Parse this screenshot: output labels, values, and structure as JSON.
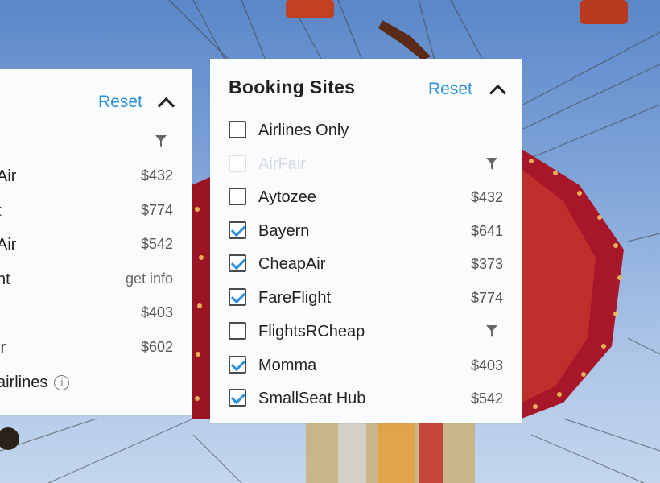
{
  "left_panel": {
    "reset_label": "Reset",
    "rows": [
      {
        "name": "Air",
        "price": "$432"
      },
      {
        "name": "t",
        "price": "$774"
      },
      {
        "name": "Air",
        "price": "$542"
      },
      {
        "name": "ht",
        "price": "get info"
      },
      {
        "name": "",
        "price": "$403"
      },
      {
        "name": "ir",
        "price": "$602"
      }
    ],
    "footer_label": "airlines"
  },
  "main_panel": {
    "title": "Booking Sites",
    "reset_label": "Reset",
    "items": [
      {
        "name": "Airlines Only",
        "price": "",
        "checked": false,
        "disabled": false,
        "filter_icon": false
      },
      {
        "name": "AirFair",
        "price": "",
        "checked": false,
        "disabled": true,
        "filter_icon": true
      },
      {
        "name": "Aytozee",
        "price": "$432",
        "checked": false,
        "disabled": false,
        "filter_icon": false
      },
      {
        "name": "Bayern",
        "price": "$641",
        "checked": true,
        "disabled": false,
        "filter_icon": false
      },
      {
        "name": "CheapAir",
        "price": "$373",
        "checked": true,
        "disabled": false,
        "filter_icon": false
      },
      {
        "name": "FareFlight",
        "price": "$774",
        "checked": true,
        "disabled": false,
        "filter_icon": false
      },
      {
        "name": "FlightsRCheap",
        "price": "",
        "checked": false,
        "disabled": false,
        "filter_icon": true
      },
      {
        "name": "Momma",
        "price": "$403",
        "checked": true,
        "disabled": false,
        "filter_icon": false
      },
      {
        "name": "SmallSeat Hub",
        "price": "$542",
        "checked": true,
        "disabled": false,
        "filter_icon": false
      }
    ]
  },
  "colors": {
    "accent": "#2b8fdb",
    "panel_bg": "#fafbfd",
    "text": "#222222",
    "muted": "#555555"
  },
  "icons": [
    "chevron-up-icon",
    "filter-icon",
    "info-icon",
    "checkmark-icon"
  ]
}
